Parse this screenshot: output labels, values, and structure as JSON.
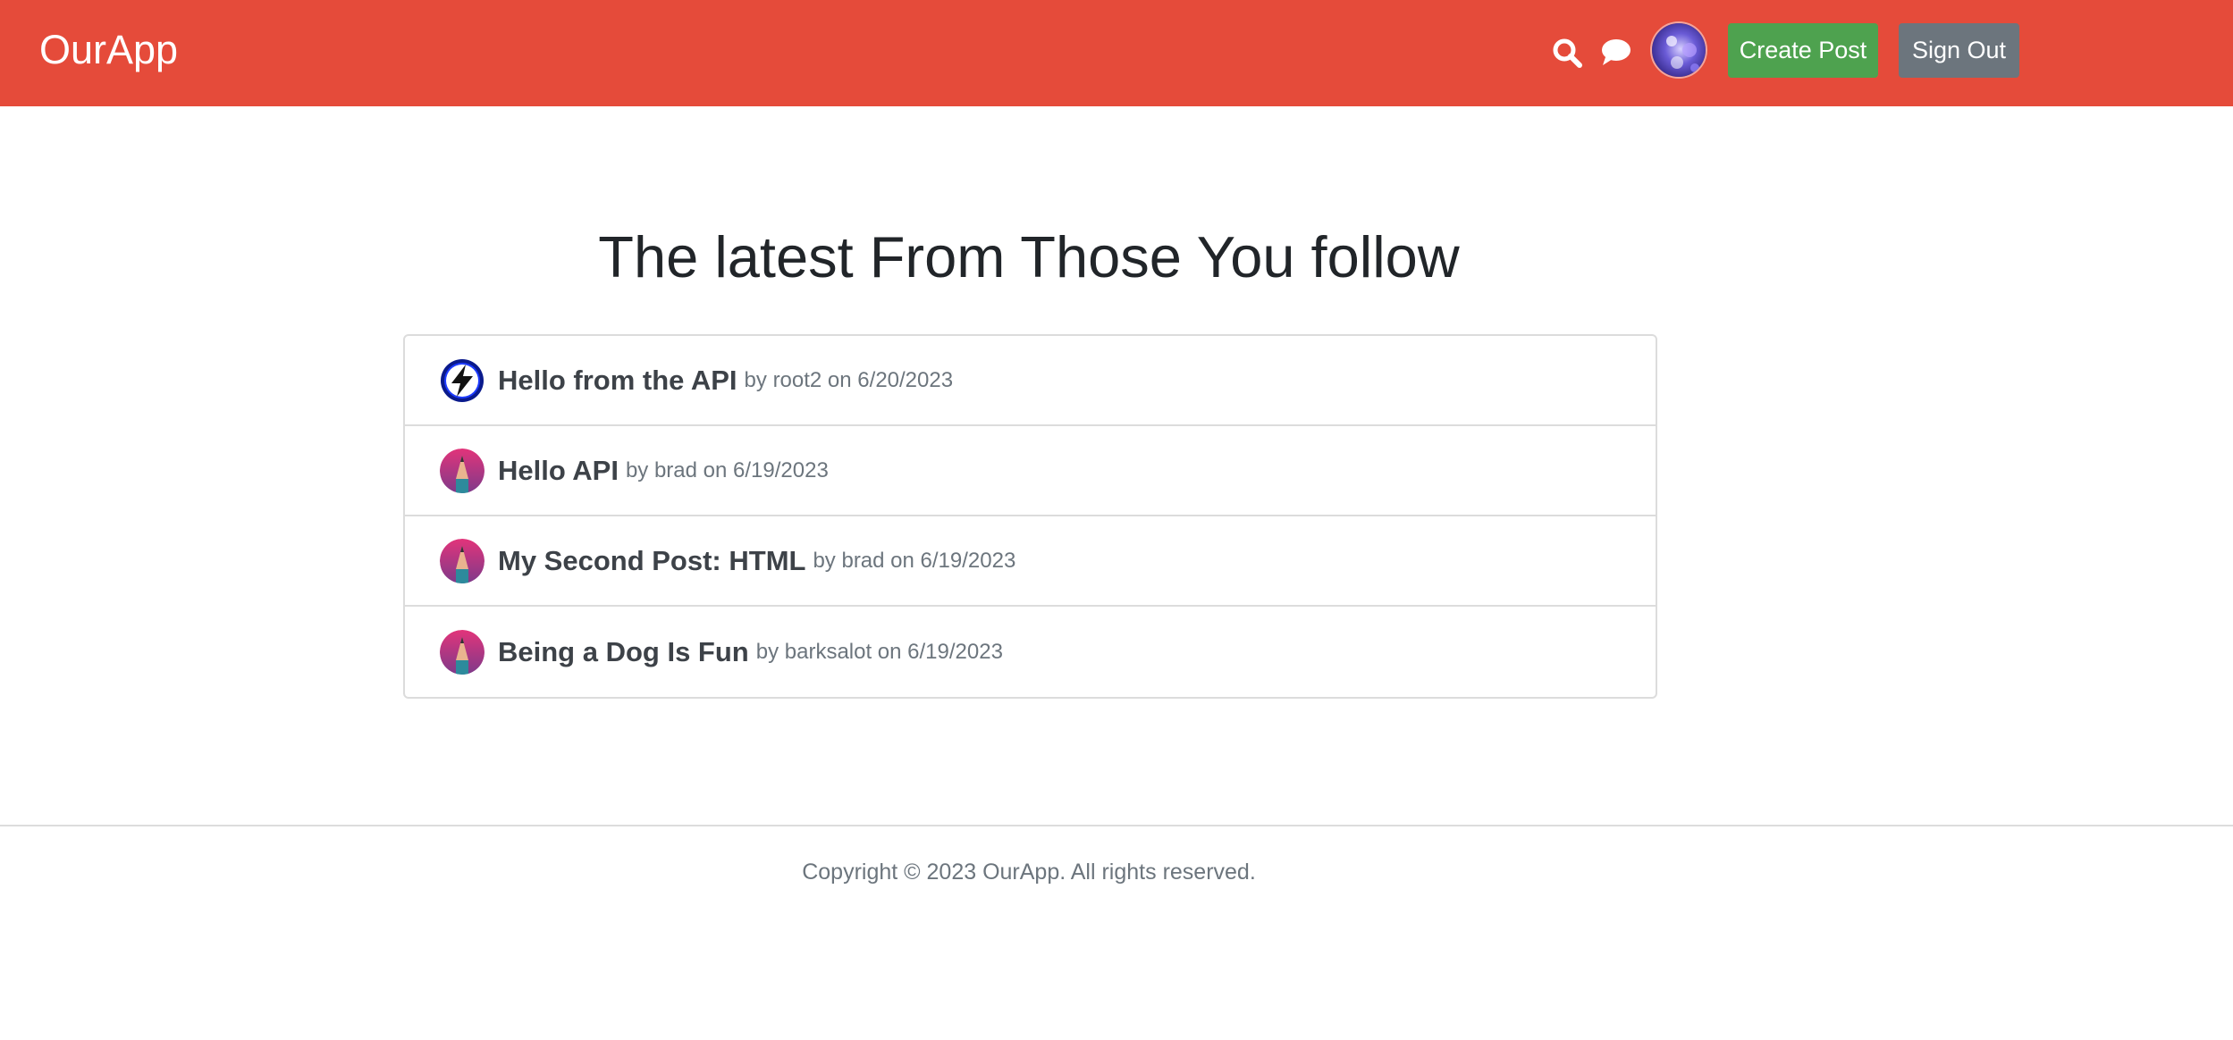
{
  "header": {
    "brand": "OurApp",
    "create_post_label": "Create Post",
    "sign_out_label": "Sign Out",
    "icons": [
      "search-icon",
      "chat-icon"
    ],
    "accent_color": "#e54b3a"
  },
  "main": {
    "title": "The latest From Those You follow",
    "posts": [
      {
        "title": "Hello from the API",
        "meta": "by root2 on 6/20/2023",
        "avatar": "lightning-avatar"
      },
      {
        "title": "Hello API",
        "meta": "by brad on 6/19/2023",
        "avatar": "pencil-avatar"
      },
      {
        "title": "My Second Post: HTML",
        "meta": "by brad on 6/19/2023",
        "avatar": "pencil-avatar"
      },
      {
        "title": "Being a Dog Is Fun",
        "meta": "by barksalot on 6/19/2023",
        "avatar": "pencil-avatar"
      }
    ]
  },
  "footer": {
    "copyright": "Copyright © 2023 OurApp. All rights reserved."
  }
}
